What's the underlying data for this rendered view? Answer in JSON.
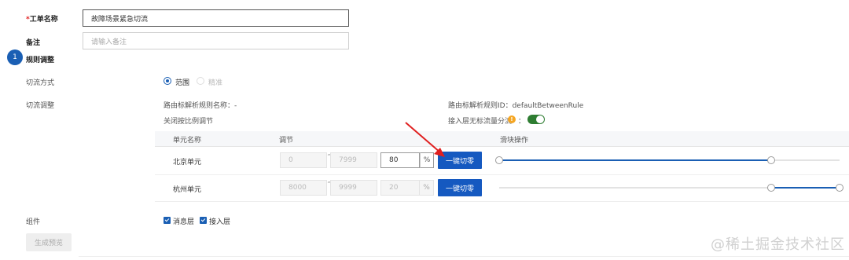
{
  "form": {
    "ticket_name": {
      "required_mark": "*",
      "label": "工单名称",
      "value": "故障场景紧急切流"
    },
    "remark": {
      "label": "备注",
      "placeholder": "请输入备注"
    }
  },
  "step": {
    "number": "1",
    "title": "规则调整"
  },
  "cut_mode": {
    "label": "切流方式",
    "options": [
      {
        "label": "范围",
        "selected": true
      },
      {
        "label": "精准",
        "selected": false
      }
    ]
  },
  "cut_adjust": {
    "label": "切流调整",
    "rule_name_label": "路由标解析规则名称：",
    "rule_name_value": "-",
    "rule_id_label": "路由标解析规则ID：",
    "rule_id_value": "defaultBetweenRule",
    "ratio_label": "关闭按比例调节",
    "access_layer_label": "接入层无标流量分流",
    "access_layer_suffix": "：",
    "access_layer_enabled": true,
    "info_icon": "info-icon",
    "info_glyph": "!"
  },
  "table": {
    "headers": {
      "unit": "单元名称",
      "adjust": "调节",
      "slider": "滑块操作"
    },
    "rows": [
      {
        "unit": "北京单元",
        "from": "0",
        "to": "7999",
        "percent": "80",
        "percent_unit": "%",
        "button": "一键切零",
        "slider_fill": 0.8
      },
      {
        "unit": "杭州单元",
        "from": "8000",
        "to": "9999",
        "percent": "20",
        "percent_unit": "%",
        "button": "一键切零",
        "slider_fill": 0.2
      }
    ],
    "range_separator": "~"
  },
  "components": {
    "label": "组件",
    "items": [
      {
        "label": "消息层",
        "checked": true
      },
      {
        "label": "接入层",
        "checked": true
      }
    ]
  },
  "generate_button": "生成预览",
  "watermark": "@稀土掘金技术社区",
  "colors": {
    "primary": "#1559c0",
    "toggle": "#2e7d32",
    "arrow": "#e02020",
    "info": "#f5a623"
  }
}
